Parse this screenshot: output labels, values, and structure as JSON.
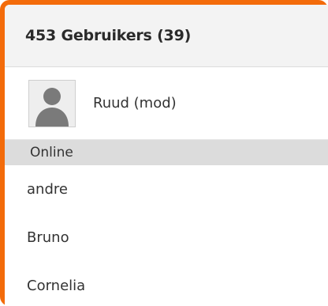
{
  "header": {
    "title": "453 Gebruikers (39)"
  },
  "moderator": {
    "name": "Ruud (mod)",
    "avatar_icon": "default-user-silhouette-icon"
  },
  "section": {
    "label": "Online"
  },
  "users": [
    {
      "name": "andre"
    },
    {
      "name": "Bruno"
    },
    {
      "name": "Cornelia"
    }
  ],
  "colors": {
    "accent_border": "#f36b0a",
    "header_bg": "#f3f3f3",
    "section_bg": "#dcdcdc"
  }
}
